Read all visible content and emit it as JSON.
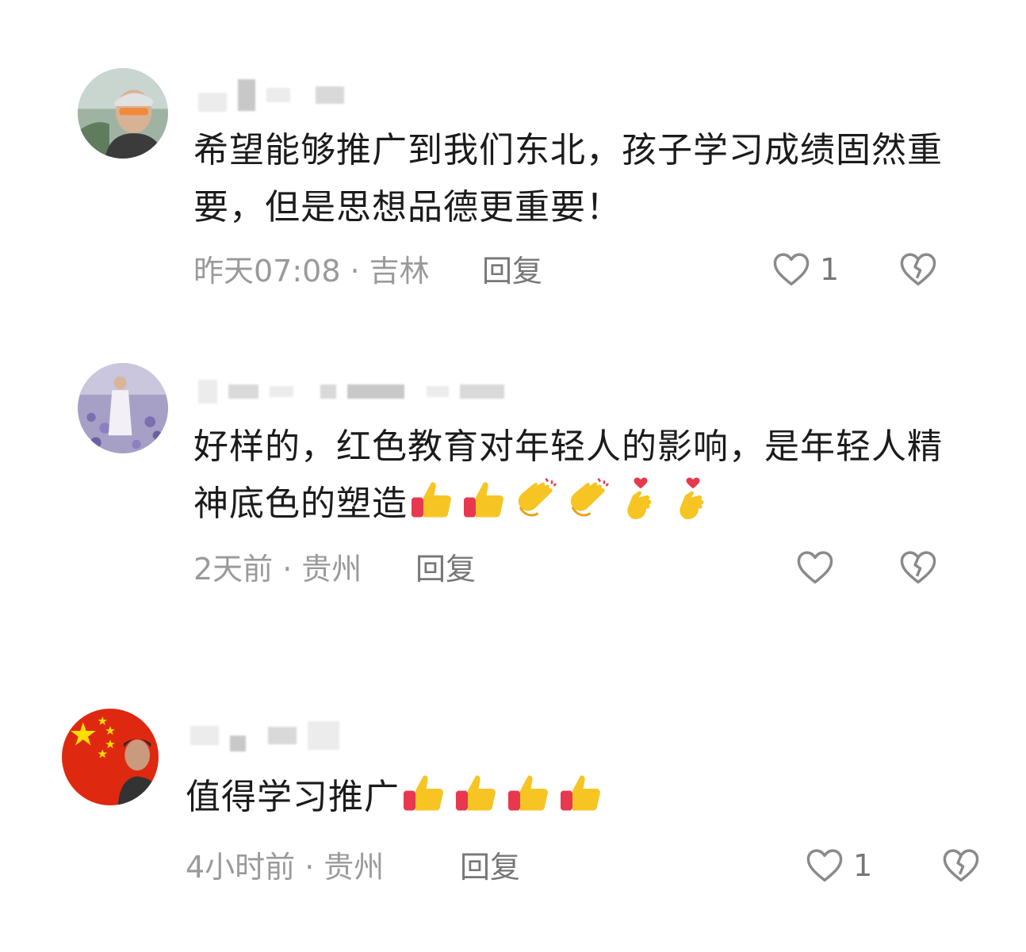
{
  "comments": [
    {
      "text": "希望能够推广到我们东北，孩子学习成绩固然重要，但是思想品德更重要！",
      "time": "昨天07:08",
      "location": "吉林",
      "reply_label": "回复",
      "like_count": "1",
      "emojis": [],
      "avatar_icon": "man-sunglasses-avatar"
    },
    {
      "text": "好样的，红色教育对年轻人的影响，是年轻人精神底色的塑造",
      "time": "2天前",
      "location": "贵州",
      "reply_label": "回复",
      "like_count": "",
      "emojis": [
        "thumbs-up",
        "thumbs-up",
        "clapping-hands",
        "clapping-hands",
        "finger-heart",
        "finger-heart"
      ],
      "avatar_icon": "flower-field-avatar"
    },
    {
      "text": "值得学习推广",
      "time": "4小时前",
      "location": "贵州",
      "reply_label": "回复",
      "like_count": "1",
      "emojis": [
        "thumbs-up",
        "thumbs-up",
        "thumbs-up",
        "thumbs-up"
      ],
      "avatar_icon": "china-flag-avatar"
    }
  ],
  "separator": "·",
  "colors": {
    "text": "#1b1b1b",
    "meta": "#9a9a9a",
    "reply": "#777777",
    "emoji_yellow": "#f7c523",
    "emoji_red": "#e8384f"
  }
}
